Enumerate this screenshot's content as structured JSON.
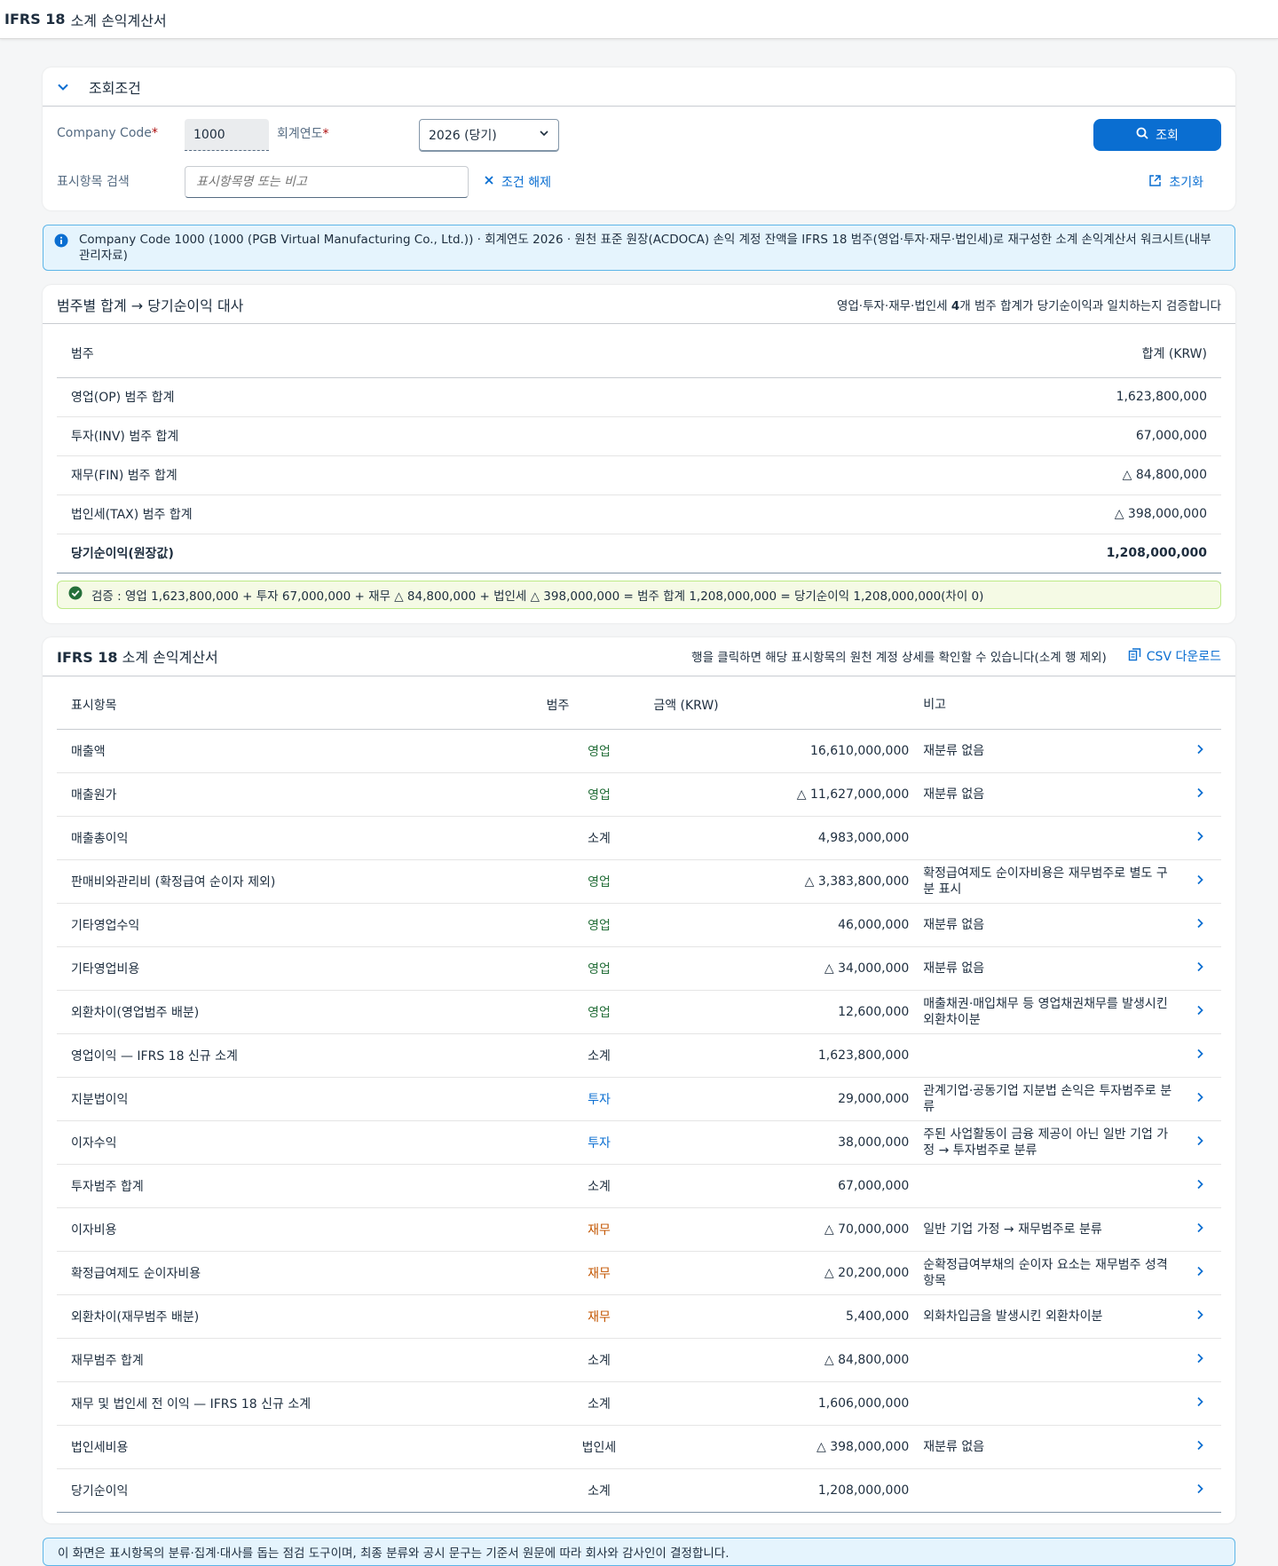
{
  "app": {
    "title_strong": "IFRS 18",
    "title_rest": "소계 손익계산서"
  },
  "filter": {
    "header": "조회조건",
    "company_code_label": "Company Code",
    "company_code_value": "1000",
    "fiscal_year_label": "회계연도",
    "fiscal_year_value": "2026 (당기)",
    "search_button": "조회",
    "item_search_label": "표시항목 검색",
    "item_search_placeholder": "표시항목명 또는 비고",
    "clear_label": "조건 해제",
    "reset_label": "초기화"
  },
  "info": {
    "text": "Company Code 1000 (1000 (PGB Virtual Manufacturing Co., Ltd.)) · 회계연도 2026 · 원천 표준 원장(ACDOCA) 손익 계정 잔액을 IFRS 18 범주(영업·투자·재무·법인세)로 재구성한 소계 손익계산서 워크시트(내부관리자료)"
  },
  "summary": {
    "title": "범주별 합계 → 당기순이익 대사",
    "subtitle_pre": "영업·투자·재무·법인세 ",
    "subtitle_strong": "4",
    "subtitle_post": "개 범주 합계가 당기순이익과 일치하는지 검증합니다",
    "col_category": "범주",
    "col_total": "합계 (KRW)",
    "rows": [
      {
        "label": "영업(OP) 범주 합계",
        "value": "1,623,800,000"
      },
      {
        "label": "투자(INV) 범주 합계",
        "value": "67,000,000"
      },
      {
        "label": "재무(FIN) 범주 합계",
        "value": "△ 84,800,000"
      },
      {
        "label": "법인세(TAX) 범주 합계",
        "value": "△ 398,000,000"
      }
    ],
    "total_label": "당기순이익(원장값)",
    "total_value": "1,208,000,000",
    "check_text": "검증 : 영업 1,623,800,000 + 투자 67,000,000 + 재무 △ 84,800,000 + 법인세 △ 398,000,000 = 범주 합계 1,208,000,000 = 당기순이익 1,208,000,000(차이 0)"
  },
  "statement": {
    "title_strong": "IFRS 18",
    "title_rest": "소계 손익계산서",
    "hint": "행을 클릭하면 해당 표시항목의 원천 계정 상세를 확인할 수 있습니다(소계 행 제외)",
    "csv_label": "CSV 다운로드",
    "col_item": "표시항목",
    "col_category": "범주",
    "col_amount": "금액 (KRW)",
    "col_note": "비고",
    "rows": [
      {
        "item": "매출액",
        "category": "영업",
        "cat": "op",
        "amount": "16,610,000,000",
        "note": "재분류 없음"
      },
      {
        "item": "매출원가",
        "category": "영업",
        "cat": "op",
        "amount": "△ 11,627,000,000",
        "note": "재분류 없음"
      },
      {
        "item": "매출총이익",
        "category": "소계",
        "cat": "sub",
        "amount": "4,983,000,000",
        "note": ""
      },
      {
        "item": "판매비와관리비 (확정급여 순이자 제외)",
        "category": "영업",
        "cat": "op",
        "amount": "△ 3,383,800,000",
        "note": "확정급여제도 순이자비용은 재무범주로 별도 구분 표시"
      },
      {
        "item": "기타영업수익",
        "category": "영업",
        "cat": "op",
        "amount": "46,000,000",
        "note": "재분류 없음"
      },
      {
        "item": "기타영업비용",
        "category": "영업",
        "cat": "op",
        "amount": "△ 34,000,000",
        "note": "재분류 없음"
      },
      {
        "item": "외환차이(영업범주 배분)",
        "category": "영업",
        "cat": "op",
        "amount": "12,600,000",
        "note": "매출채권·매입채무 등 영업채권채무를 발생시킨 외환차이분"
      },
      {
        "item": "영업이익 — IFRS 18 신규 소계",
        "category": "소계",
        "cat": "sub",
        "amount": "1,623,800,000",
        "note": ""
      },
      {
        "item": "지분법이익",
        "category": "투자",
        "cat": "inv",
        "amount": "29,000,000",
        "note": "관계기업·공동기업 지분법 손익은 투자범주로 분류"
      },
      {
        "item": "이자수익",
        "category": "투자",
        "cat": "inv",
        "amount": "38,000,000",
        "note": "주된 사업활동이 금융 제공이 아닌 일반 기업 가정 → 투자범주로 분류"
      },
      {
        "item": "투자범주 합계",
        "category": "소계",
        "cat": "sub",
        "amount": "67,000,000",
        "note": ""
      },
      {
        "item": "이자비용",
        "category": "재무",
        "cat": "fin",
        "amount": "△ 70,000,000",
        "note": "일반 기업 가정 → 재무범주로 분류"
      },
      {
        "item": "확정급여제도 순이자비용",
        "category": "재무",
        "cat": "fin",
        "amount": "△ 20,200,000",
        "note": "순확정급여부채의 순이자 요소는 재무범주 성격 항목"
      },
      {
        "item": "외환차이(재무범주 배분)",
        "category": "재무",
        "cat": "fin",
        "amount": "5,400,000",
        "note": "외화차입금을 발생시킨 외환차이분"
      },
      {
        "item": "재무범주 합계",
        "category": "소계",
        "cat": "sub",
        "amount": "△ 84,800,000",
        "note": ""
      },
      {
        "item": "재무 및 법인세 전 이익 — IFRS 18 신규 소계",
        "category": "소계",
        "cat": "sub",
        "amount": "1,606,000,000",
        "note": ""
      },
      {
        "item": "법인세비용",
        "category": "법인세",
        "cat": "tax",
        "amount": "△ 398,000,000",
        "note": "재분류 없음"
      },
      {
        "item": "당기순이익",
        "category": "소계",
        "cat": "sub",
        "amount": "1,208,000,000",
        "note": ""
      }
    ]
  },
  "footer": {
    "text": "이 화면은 표시항목의 분류·집계·대사를 돕는 점검 도구이며, 최종 분류와 공시 문구는 기준서 원문에 따라 회사와 감사인이 결정합니다."
  },
  "colors": {
    "accent": "#0a6ed1",
    "operating": "#256f3a",
    "investing": "#0a6ed1",
    "financing": "#c35500",
    "info_bg": "#e5f4fd",
    "success_bg": "#f5fae5"
  },
  "icons": {
    "collapse": "chevron-down-icon",
    "search": "search-icon",
    "clear": "close-icon",
    "reset": "reset-icon",
    "info": "info-icon",
    "check": "success-check-icon",
    "csv": "csv-export-icon",
    "nav": "chevron-right-icon"
  }
}
